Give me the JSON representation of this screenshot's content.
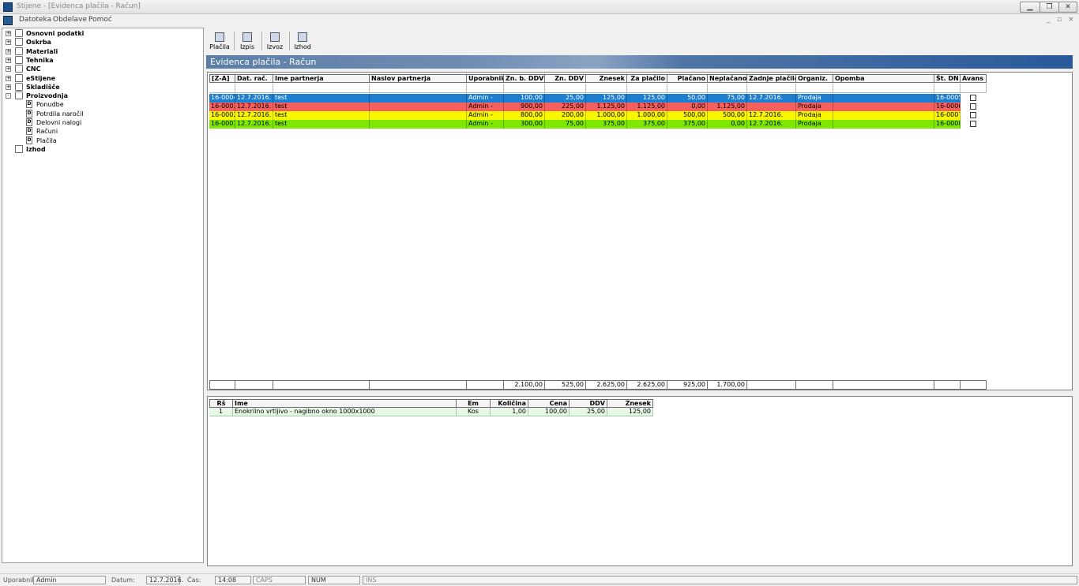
{
  "window": {
    "title": "Stijene - [Evidenca plačila - Račun]"
  },
  "menu": [
    "Datoteka",
    "Obdelave",
    "Pomoć"
  ],
  "tree": [
    {
      "label": "Osnovni podatki",
      "bold": true,
      "expander": "+"
    },
    {
      "label": "Oskrba",
      "bold": true,
      "expander": "+"
    },
    {
      "label": "Materiali",
      "bold": true,
      "expander": "+"
    },
    {
      "label": "Tehnika",
      "bold": true,
      "expander": "+"
    },
    {
      "label": "CNC",
      "bold": true,
      "expander": "+"
    },
    {
      "label": "eStijene",
      "bold": true,
      "expander": "+"
    },
    {
      "label": "Skladišče",
      "bold": true,
      "expander": "+"
    },
    {
      "label": "Proizvodnja",
      "bold": true,
      "expander": "-"
    },
    {
      "label": "Ponudbe",
      "child": true
    },
    {
      "label": "Potrdila naročil",
      "child": true
    },
    {
      "label": "Delovni nalogi",
      "child": true
    },
    {
      "label": "Računi",
      "child": true
    },
    {
      "label": "Plačila",
      "child": true
    },
    {
      "label": "Izhod",
      "bold": true
    }
  ],
  "toolbar": [
    {
      "label": "Plačila",
      "icon": "payments-icon"
    },
    {
      "label": "Izpis",
      "icon": "printer-icon"
    },
    {
      "label": "Izvoz",
      "icon": "export-icon"
    },
    {
      "label": "Izhod",
      "icon": "exit-icon"
    }
  ],
  "banner": {
    "title": "Evidenca plačila - Račun"
  },
  "grid": {
    "headers": [
      "[Z-A]",
      "Dat. rač.",
      "Ime partnerja",
      "Naslov partnerja",
      "Uporabnik",
      "Zn. b. DDV",
      "Zn. DDV",
      "Znesek",
      "Za plačilo",
      "Plačano",
      "Neplačano",
      "Zadnje plačilo",
      "Organiz.",
      "Opomba",
      "Št. DN",
      "Avans"
    ],
    "rows": [
      {
        "color": "#1c7fd2",
        "text": "#ffffff",
        "cells": [
          "16-0004",
          "12.7.2016. 1:",
          "test",
          "",
          "Admin -",
          "100,00",
          "25,00",
          "125,00",
          "125,00",
          "50,00",
          "75,00",
          "12.7.2016.",
          "Prodaja",
          "",
          "16-0005",
          ""
        ]
      },
      {
        "color": "#f5605e",
        "text": "#000000",
        "cells": [
          "16-0003",
          "12.7.2016. 1:",
          "test",
          "",
          "Admin -",
          "900,00",
          "225,00",
          "1.125,00",
          "1.125,00",
          "0,00",
          "1.125,00",
          "",
          "Prodaja",
          "",
          "16-0006",
          ""
        ]
      },
      {
        "color": "#f7f700",
        "text": "#000000",
        "cells": [
          "16-0002",
          "12.7.2016. 1:",
          "test",
          "",
          "Admin -",
          "800,00",
          "200,00",
          "1.000,00",
          "1.000,00",
          "500,00",
          "500,00",
          "12.7.2016.",
          "Prodaja",
          "",
          "16-0007",
          ""
        ]
      },
      {
        "color": "#7ee800",
        "text": "#000000",
        "cells": [
          "16-0001",
          "12.7.2016. 1:",
          "test",
          "",
          "Admin -",
          "300,00",
          "75,00",
          "375,00",
          "375,00",
          "375,00",
          "0,00",
          "12.7.2016.",
          "Prodaja",
          "",
          "16-0008",
          ""
        ]
      }
    ],
    "totals": [
      "",
      "",
      "",
      "",
      "",
      "2.100,00",
      "525,00",
      "2.625,00",
      "2.625,00",
      "925,00",
      "1.700,00",
      "",
      "",
      "",
      "",
      ""
    ]
  },
  "detail": {
    "headers": [
      "Rš",
      "Ime",
      "Em",
      "Količina",
      "Cena",
      "DDV",
      "Znesek"
    ],
    "rows": [
      {
        "cells": [
          "1",
          "Enokrilno vrtljivo - nagibno okno 1000x1000",
          "Kos",
          "1,00",
          "100,00",
          "25,00",
          "125,00"
        ]
      }
    ],
    "row_color": "#e8f8e8"
  },
  "status": {
    "user_label": "Uporabnik:",
    "user": "Admin",
    "date_label": "Datum:",
    "date": "12.7.2016.",
    "time_label": "Čas:",
    "time": "14:08",
    "caps": "CAPS",
    "num": "NUM",
    "ins": "INS"
  }
}
